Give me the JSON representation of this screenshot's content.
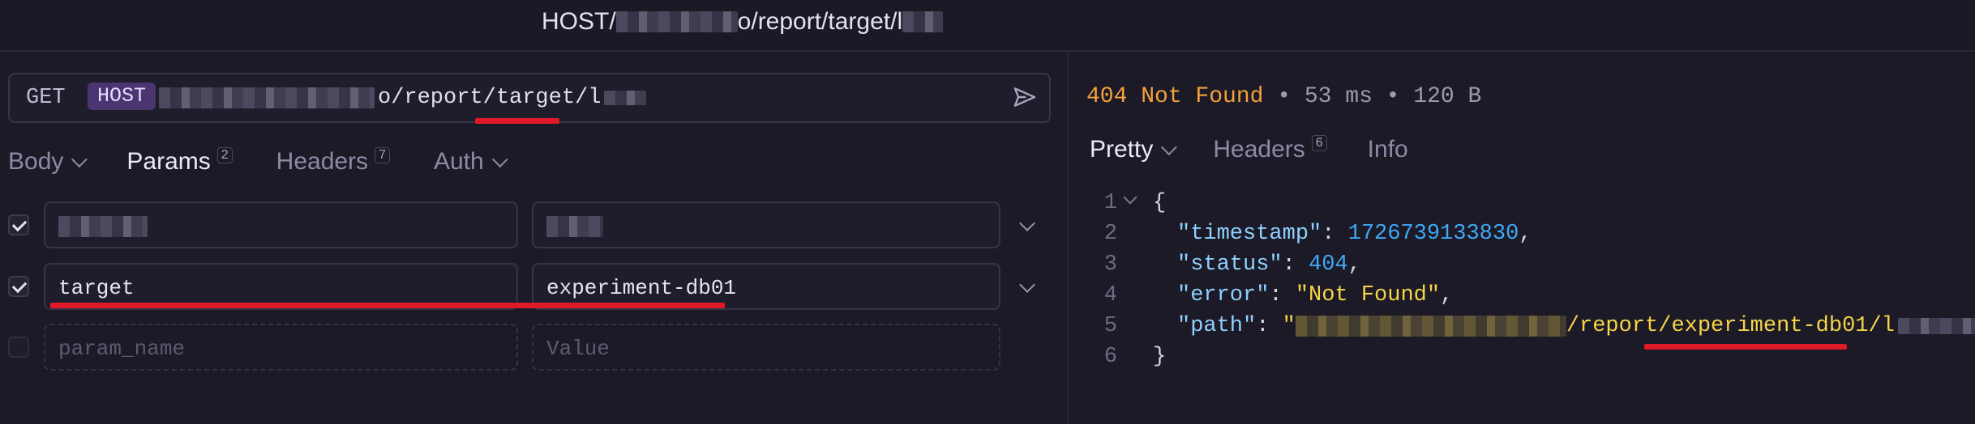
{
  "window": {
    "title_prefix": "HOST/",
    "title_suffix": "o/report/target/l"
  },
  "request": {
    "method": "GET",
    "host_chip": "HOST",
    "url_suffix": "o/report/target/l"
  },
  "request_tabs": [
    {
      "label": "Body",
      "badge": ""
    },
    {
      "label": "Params",
      "badge": "2"
    },
    {
      "label": "Headers",
      "badge": "7"
    },
    {
      "label": "Auth",
      "badge": ""
    }
  ],
  "params": [
    {
      "checked": true,
      "name": "",
      "value": ""
    },
    {
      "checked": true,
      "name": "target",
      "value": "experiment-db01"
    },
    {
      "checked": false,
      "name_placeholder": "param_name",
      "value_placeholder": "Value"
    }
  ],
  "response": {
    "status": "404 Not Found",
    "meta": "• 53 ms • 120 B",
    "tabs": [
      {
        "label": "Pretty",
        "badge": ""
      },
      {
        "label": "Headers",
        "badge": "6"
      },
      {
        "label": "Info",
        "badge": ""
      }
    ],
    "body": {
      "line_numbers": [
        "1",
        "2",
        "3",
        "4",
        "5",
        "6"
      ],
      "open_brace": "{",
      "close_brace": "}",
      "timestamp_key": "\"timestamp\"",
      "timestamp_val": "1726739133830",
      "status_key": "\"status\"",
      "status_val": "404",
      "error_key": "\"error\"",
      "error_val": "\"Not Found\"",
      "path_key": "\"path\"",
      "path_quote": "\"",
      "path_visible": "/report/experiment-db01/l"
    }
  },
  "colors": {
    "accent_status": "#f4a23c",
    "annotation_red": "#e01a28",
    "host_chip": "#4b3570"
  }
}
